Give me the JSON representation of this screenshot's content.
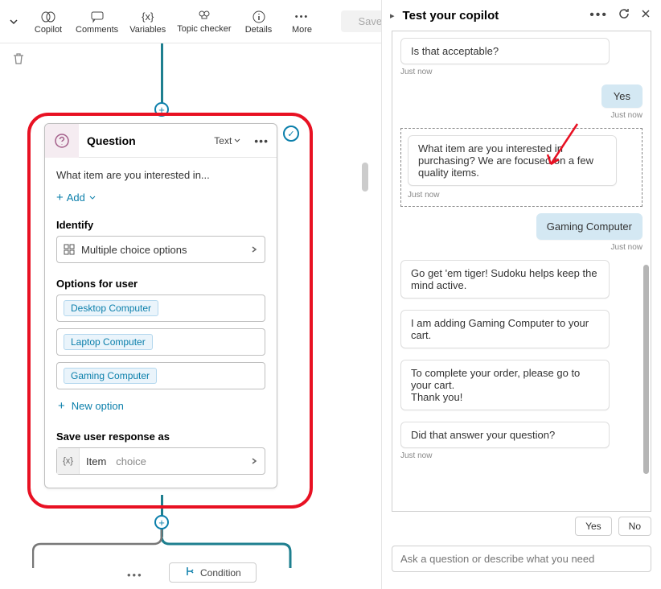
{
  "toolbar": {
    "copilot": "Copilot",
    "comments": "Comments",
    "variables": "Variables",
    "topic_checker": "Topic checker",
    "details": "Details",
    "more": "More",
    "save": "Save"
  },
  "question": {
    "title": "Question",
    "type": "Text",
    "message": "What item are you interested in...",
    "add": "Add",
    "identify_label": "Identify",
    "identify_value": "Multiple choice options",
    "options_label": "Options for user",
    "options": [
      "Desktop Computer",
      "Laptop Computer",
      "Gaming Computer"
    ],
    "new_option": "New option",
    "save_label": "Save user response as",
    "var_name": "Item",
    "var_type": "choice"
  },
  "condition_label": "Condition",
  "panel": {
    "title": "Test your copilot",
    "msg1": "Is that acceptable?",
    "ts": "Just now",
    "reply1": "Yes",
    "msg2": "What item are you interested in purchasing? We are focused on a few quality items.",
    "reply2": "Gaming Computer",
    "msg3": "Go get 'em tiger! Sudoku helps keep the mind active.",
    "msg4": "I am adding Gaming Computer to your cart.",
    "msg5": "To complete your order, please go to your cart.\nThank you!",
    "msg6": "Did that answer your question?",
    "suggest_yes": "Yes",
    "suggest_no": "No",
    "input_placeholder": "Ask a question or describe what you need"
  }
}
